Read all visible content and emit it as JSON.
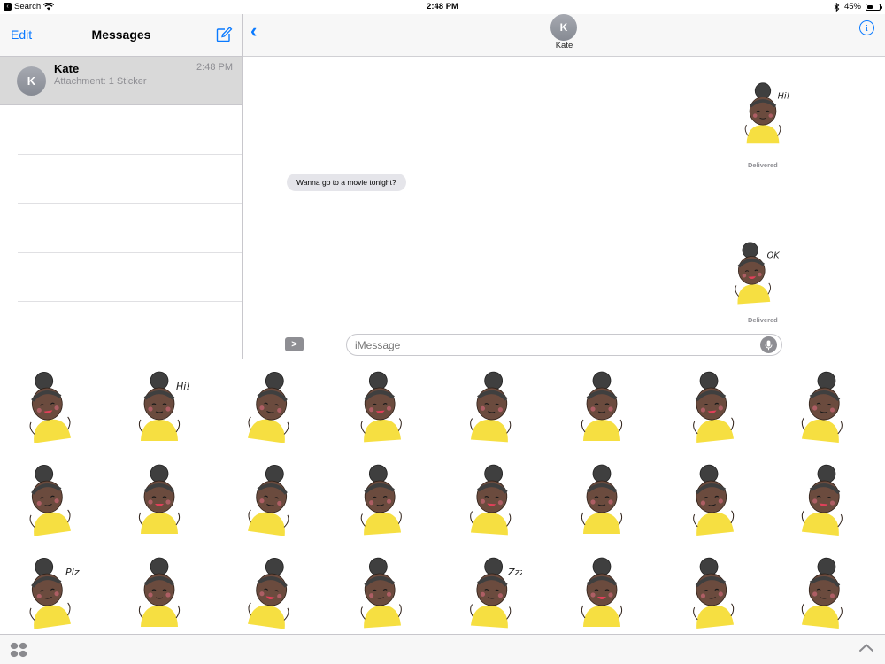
{
  "status_bar": {
    "back_app": "Search",
    "time": "2:48 PM",
    "battery": "45%",
    "battery_level": 0.45,
    "icons": [
      "wifi-icon",
      "bluetooth-icon",
      "battery-icon"
    ]
  },
  "sidebar": {
    "edit_label": "Edit",
    "title": "Messages",
    "compose_icon": "compose-icon",
    "conversations": [
      {
        "initial": "K",
        "name": "Kate",
        "time": "2:48 PM",
        "preview": "Attachment: 1 Sticker"
      }
    ]
  },
  "conversation": {
    "contact_initial": "K",
    "contact_name": "Kate",
    "back_icon": "chevron-left-icon",
    "info_icon": "info-icon",
    "info_glyph": "i",
    "messages": [
      {
        "type": "sticker",
        "sender": "me",
        "sticker": "hi-wave",
        "caption": "Hi!",
        "status": "Delivered"
      },
      {
        "type": "text",
        "sender": "them",
        "text": "Wanna go to a movie tonight?"
      },
      {
        "type": "sticker",
        "sender": "me",
        "sticker": "ok-gesture",
        "caption": "OK",
        "status": "Delivered"
      }
    ]
  },
  "composer": {
    "apps_glyph": ">",
    "placeholder": "iMessage",
    "mic_icon": "microphone-icon"
  },
  "sticker_drawer": {
    "stickers": [
      {
        "name": "neutral",
        "caption": ""
      },
      {
        "name": "hi-wave",
        "caption": "Hi!"
      },
      {
        "name": "laughing-cover",
        "caption": ""
      },
      {
        "name": "giggle",
        "caption": ""
      },
      {
        "name": "praying",
        "caption": ""
      },
      {
        "name": "sad-stand",
        "caption": ""
      },
      {
        "name": "tongue-out",
        "caption": ""
      },
      {
        "name": "phone-angry",
        "caption": ""
      },
      {
        "name": "selfie-peace",
        "caption": ""
      },
      {
        "name": "shrug",
        "caption": ""
      },
      {
        "name": "crying",
        "caption": ""
      },
      {
        "name": "excited",
        "caption": ""
      },
      {
        "name": "heart-eyes",
        "caption": ""
      },
      {
        "name": "pointing",
        "caption": ""
      },
      {
        "name": "kiss-hearts",
        "caption": ""
      },
      {
        "name": "knife-angry",
        "caption": ""
      },
      {
        "name": "please",
        "caption": "Plz"
      },
      {
        "name": "blushing",
        "caption": ""
      },
      {
        "name": "thinking",
        "caption": ""
      },
      {
        "name": "eating",
        "caption": ""
      },
      {
        "name": "sleeping",
        "caption": "Zzz"
      },
      {
        "name": "music",
        "caption": ""
      },
      {
        "name": "grimace",
        "caption": ""
      },
      {
        "name": "heartbroken",
        "caption": ""
      }
    ],
    "grid_icon": "app-drawer-icon",
    "expand_icon": "chevron-up-icon"
  },
  "colors": {
    "accent": "#0a7aff",
    "skin": "#6b4b3e",
    "hair": "#3f3f3f",
    "shirt": "#f5dc2c",
    "selected_row": "#d9d9d9",
    "bubble": "#e5e5ea"
  }
}
